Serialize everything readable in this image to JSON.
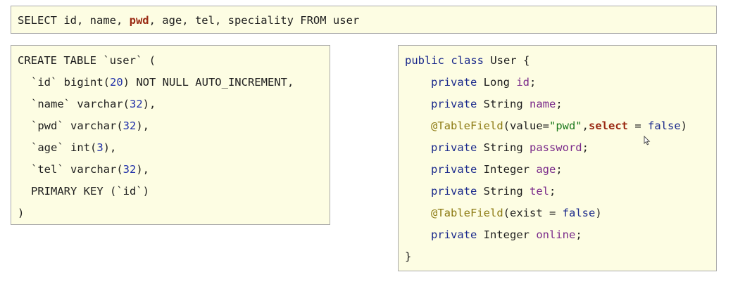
{
  "sql_query": {
    "prefix": "SELECT id, name, ",
    "highlight": "pwd",
    "suffix": ", age, tel, speciality FROM user"
  },
  "ddl": {
    "lines": [
      {
        "t1": "CREATE TABLE `user` ("
      },
      {
        "t1": "`id` bigint(",
        "n": "20",
        "t2": ") NOT NULL AUTO_INCREMENT,"
      },
      {
        "t1": "`name` varchar(",
        "n": "32",
        "t2": "),"
      },
      {
        "t1": "`pwd` varchar(",
        "n": "32",
        "t2": "),"
      },
      {
        "t1": "`age` int(",
        "n": "3",
        "t2": "),"
      },
      {
        "t1": "`tel` varchar(",
        "n": "32",
        "t2": "),"
      },
      {
        "t1": "PRIMARY KEY (`id`)"
      },
      {
        "t1": ")"
      }
    ]
  },
  "java": {
    "class_kw": "public class",
    "class_name": " User {",
    "private_kw": "private",
    "fields": [
      {
        "type": " Long ",
        "name": "id",
        "end": ";"
      },
      {
        "type": " String ",
        "name": "name",
        "end": ";"
      },
      {
        "type": " String ",
        "name": "password",
        "end": ";"
      },
      {
        "type": " Integer ",
        "name": "age",
        "end": ";"
      },
      {
        "type": " String ",
        "name": "tel",
        "end": ";"
      },
      {
        "type": " Integer ",
        "name": "online",
        "end": ";"
      }
    ],
    "annotation1": {
      "name": "@TableField",
      "open": "(value=",
      "string": "\"pwd\"",
      "comma": ",",
      "select": "select",
      "eq": " = ",
      "false": "false",
      "close": ")"
    },
    "annotation2": {
      "name": "@TableField",
      "open": "(exist = ",
      "false": "false",
      "close": ")"
    },
    "closing": "}"
  },
  "colors": {
    "panel_bg": "#fdfde3",
    "highlight": "#9a2a14",
    "keyword": "#1b2a8c",
    "field": "#7a2a8a",
    "annotation": "#8c7a12",
    "string": "#1e7a1e",
    "number": "#1f2fa8"
  }
}
